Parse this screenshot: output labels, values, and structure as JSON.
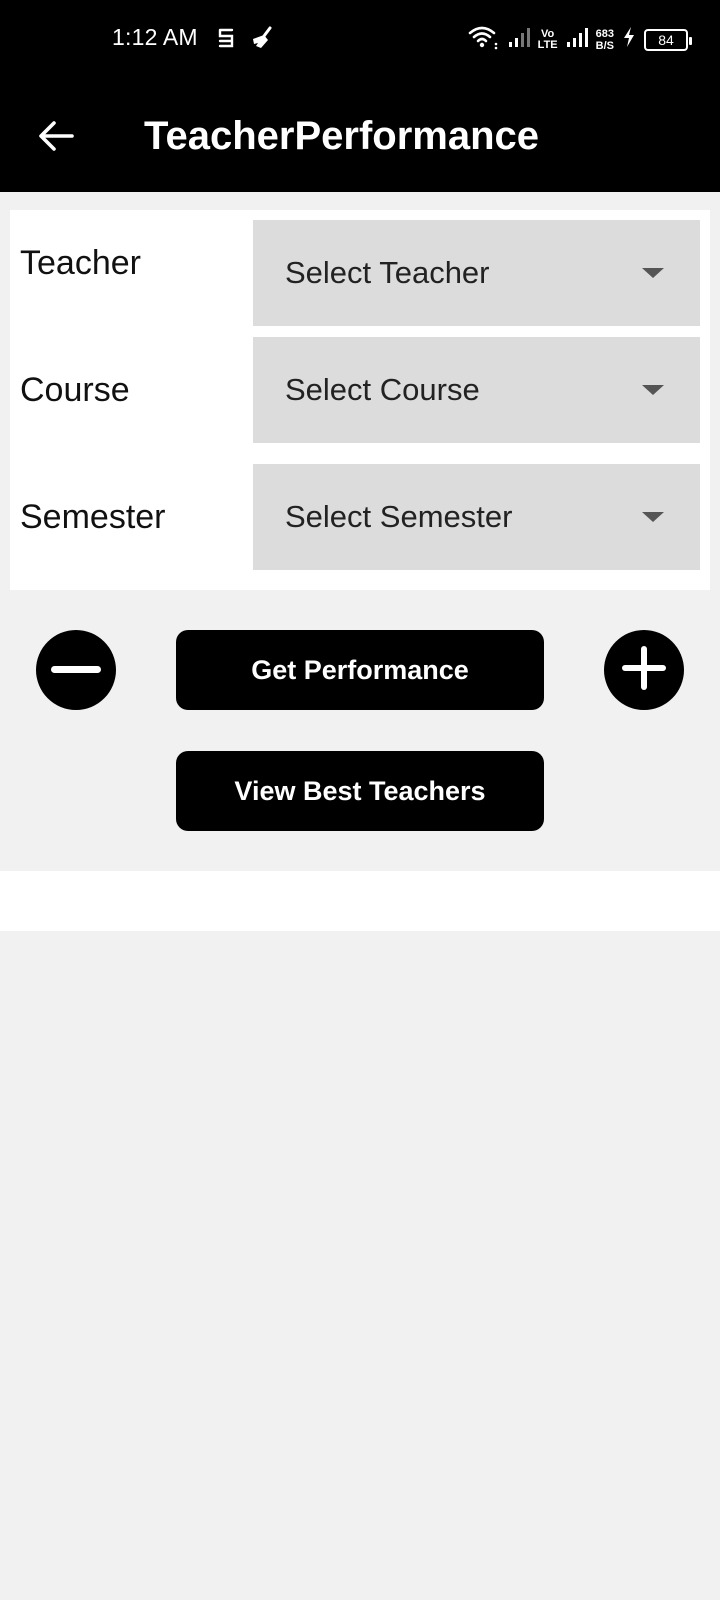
{
  "status_bar": {
    "time": "1:12 AM",
    "network_speed_value": "683",
    "network_speed_unit": "B/S",
    "volte_top": "Vo",
    "volte_bottom": "LTE",
    "battery": "84"
  },
  "app_bar": {
    "title": "TeacherPerformance"
  },
  "form": {
    "teacher": {
      "label": "Teacher",
      "placeholder": "Select Teacher"
    },
    "course": {
      "label": "Course",
      "placeholder": "Select Course"
    },
    "semester": {
      "label": "Semester",
      "placeholder": "Select Semester"
    }
  },
  "actions": {
    "get_performance": "Get Performance",
    "view_best_teachers": "View Best Teachers"
  },
  "colors": {
    "bar_background": "#000000",
    "page_background": "#f1f1f1",
    "dropdown_background": "#dcdcdc",
    "button_background": "#000000"
  }
}
